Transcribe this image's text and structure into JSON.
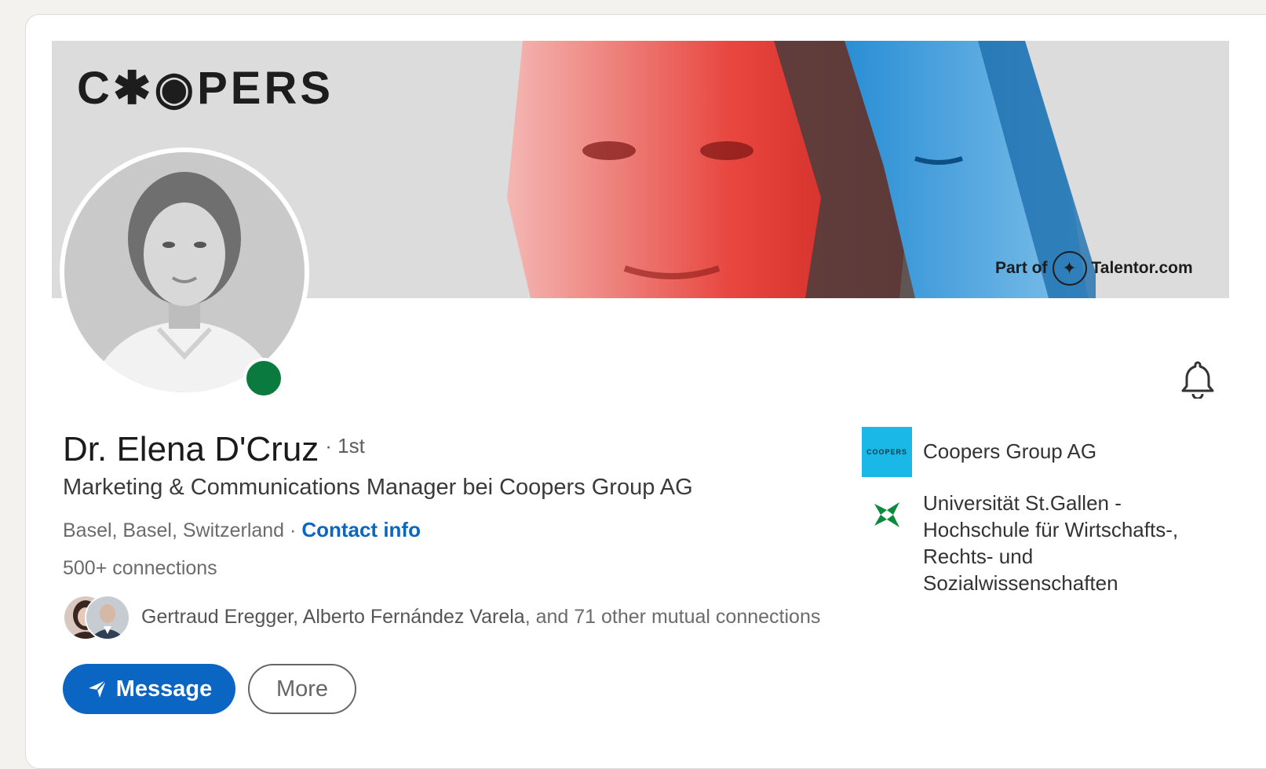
{
  "banner": {
    "logo_text": "C✱◉PERS",
    "partner_prefix": "Part of",
    "partner_name": "Talentor.com",
    "colors": {
      "red": "#e8322e",
      "blue": "#1f7fc4",
      "background": "#dcdcdc"
    }
  },
  "profile": {
    "name": "Dr. Elena D'Cruz",
    "degree": "· 1st",
    "headline": "Marketing & Communications Manager bei Coopers Group AG",
    "location": "Basel, Basel, Switzerland",
    "separator": " · ",
    "contact_link": "Contact info",
    "connections": "500+ connections",
    "online_status_color": "#0b7a3e"
  },
  "mutual": {
    "names": "Gertraud Eregger, Alberto Fernández Varela",
    "suffix": ", and 71 other mutual connections"
  },
  "actions": {
    "message_label": "Message",
    "more_label": "More"
  },
  "organizations": [
    {
      "name": "Coopers Group AG",
      "logo_text": "COOPERS",
      "logo_color": "#1ab8e6"
    },
    {
      "name": "Universität St.Gallen - Hochschule für Wirtschafts-, Rechts- und Sozialwissenschaften",
      "logo_color": "#0a8a3b"
    }
  ],
  "accent_color": "#0a66c2"
}
